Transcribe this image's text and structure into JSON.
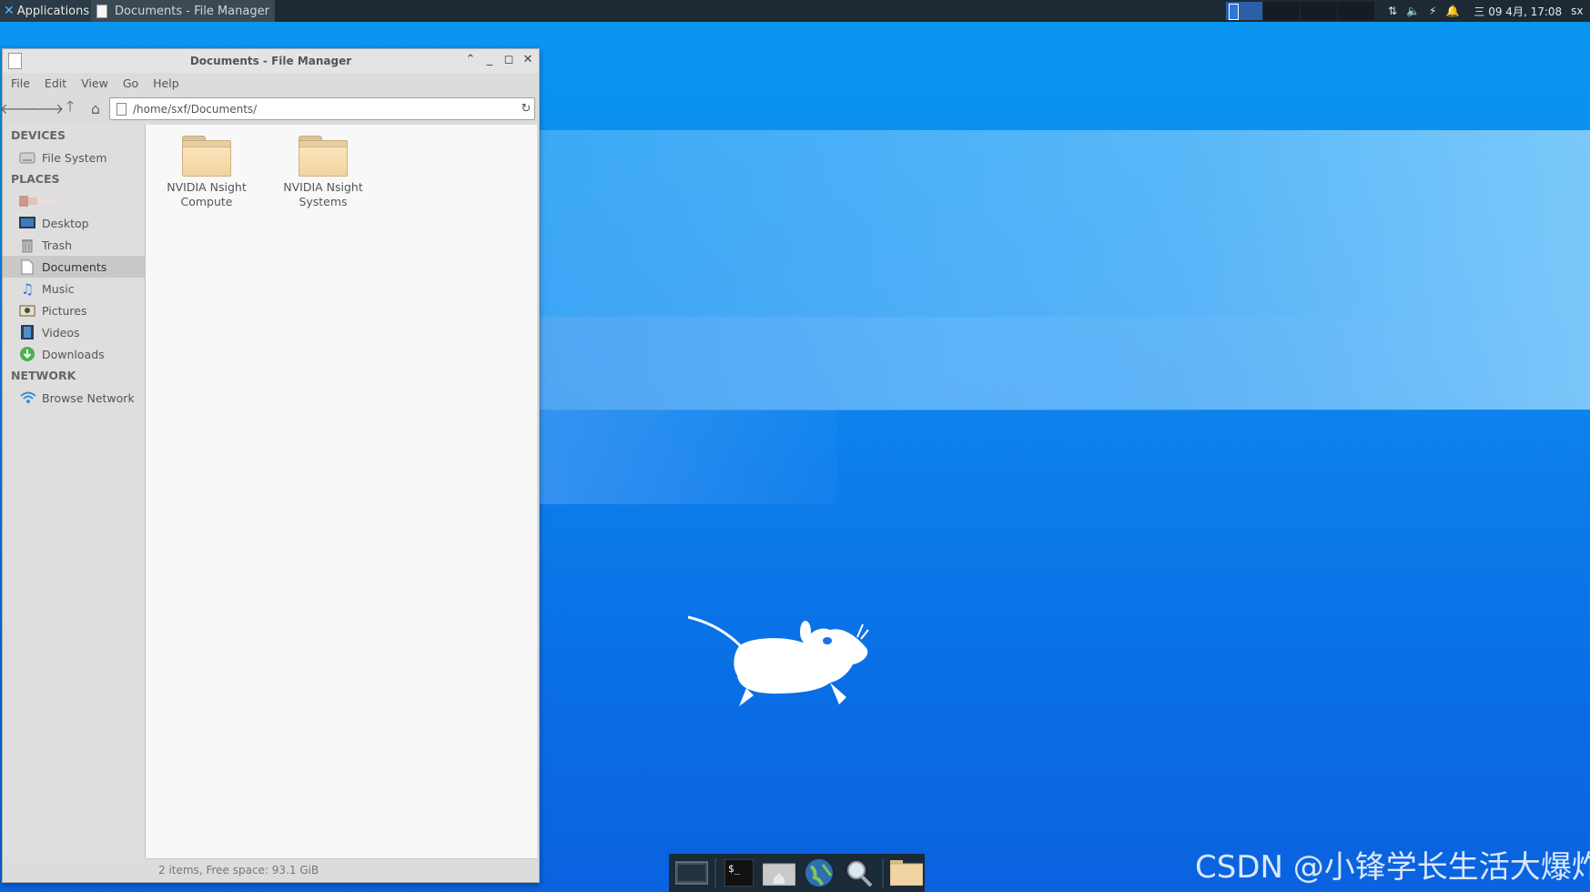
{
  "top_panel": {
    "applications_label": "Applications",
    "task_label": "Documents - File Manager",
    "clock": "三 09 4月, 17:08",
    "user": "sx"
  },
  "window": {
    "title": "Documents - File Manager",
    "menu": [
      "File",
      "Edit",
      "View",
      "Go",
      "Help"
    ],
    "location": "/home/sxf/Documents/",
    "sidebar": {
      "devices_header": "DEVICES",
      "devices": [
        {
          "label": "File System",
          "icon": "drive-icon"
        }
      ],
      "places_header": "PLACES",
      "places": [
        {
          "label": "",
          "icon": "home-icon"
        },
        {
          "label": "Desktop",
          "icon": "desktop-icon"
        },
        {
          "label": "Trash",
          "icon": "trash-icon"
        },
        {
          "label": "Documents",
          "icon": "document-icon"
        },
        {
          "label": "Music",
          "icon": "music-icon"
        },
        {
          "label": "Pictures",
          "icon": "pictures-icon"
        },
        {
          "label": "Videos",
          "icon": "videos-icon"
        },
        {
          "label": "Downloads",
          "icon": "downloads-icon"
        }
      ],
      "network_header": "NETWORK",
      "network": [
        {
          "label": "Browse Network",
          "icon": "network-icon"
        }
      ]
    },
    "files": [
      {
        "line1": "NVIDIA Nsight",
        "line2": "Compute"
      },
      {
        "line1": "NVIDIA Nsight",
        "line2": "Systems"
      }
    ],
    "status": "2 items, Free space: 93.1 GiB"
  },
  "watermark": "CSDN @小锋学长生活大爆炸",
  "colors": {
    "desktop_blue": "#0a86ee",
    "panel": "#1e2a33",
    "selection": "#c9c9c9"
  }
}
